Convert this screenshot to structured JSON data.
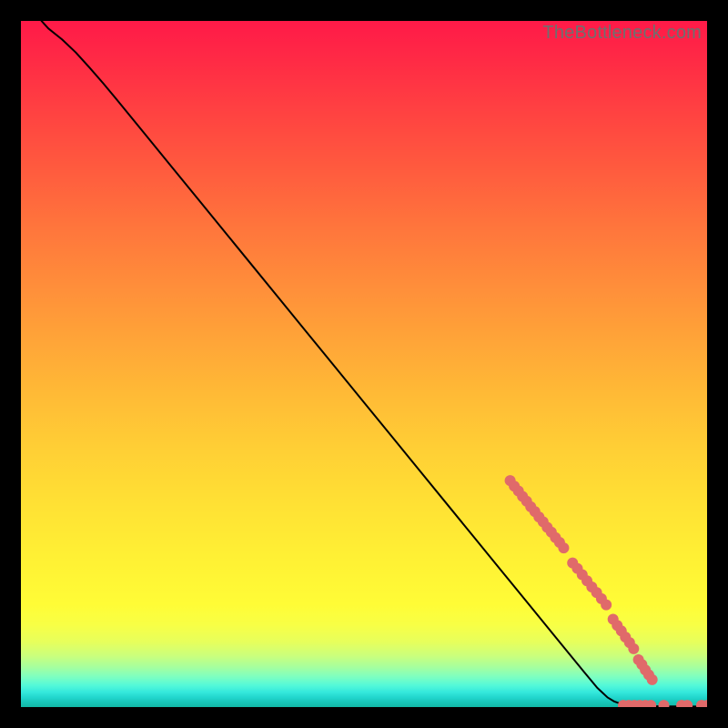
{
  "watermark": "TheBottleneck.com",
  "chart_data": {
    "type": "line",
    "title": "",
    "xlabel": "",
    "ylabel": "",
    "xlim": [
      0,
      100
    ],
    "ylim": [
      0,
      100
    ],
    "grid": false,
    "series": [
      {
        "name": "curve",
        "type": "line",
        "color": "#000000",
        "points": [
          {
            "x": 3.0,
            "y": 100.0
          },
          {
            "x": 4.0,
            "y": 98.9
          },
          {
            "x": 6.0,
            "y": 97.3
          },
          {
            "x": 8.0,
            "y": 95.4
          },
          {
            "x": 10.0,
            "y": 93.2
          },
          {
            "x": 12.0,
            "y": 90.9
          },
          {
            "x": 14.0,
            "y": 88.5
          },
          {
            "x": 18.0,
            "y": 83.6
          },
          {
            "x": 22.0,
            "y": 78.7
          },
          {
            "x": 26.0,
            "y": 73.8
          },
          {
            "x": 30.0,
            "y": 68.9
          },
          {
            "x": 34.0,
            "y": 64.0
          },
          {
            "x": 38.0,
            "y": 59.1
          },
          {
            "x": 42.0,
            "y": 54.2
          },
          {
            "x": 46.0,
            "y": 49.3
          },
          {
            "x": 50.0,
            "y": 44.4
          },
          {
            "x": 54.0,
            "y": 39.5
          },
          {
            "x": 58.0,
            "y": 34.6
          },
          {
            "x": 62.0,
            "y": 29.7
          },
          {
            "x": 66.0,
            "y": 24.8
          },
          {
            "x": 70.0,
            "y": 19.9
          },
          {
            "x": 74.0,
            "y": 15.0
          },
          {
            "x": 78.0,
            "y": 10.1
          },
          {
            "x": 82.0,
            "y": 5.2
          },
          {
            "x": 84.0,
            "y": 2.8
          },
          {
            "x": 85.5,
            "y": 1.4
          },
          {
            "x": 86.5,
            "y": 0.8
          },
          {
            "x": 87.5,
            "y": 0.45
          },
          {
            "x": 89.0,
            "y": 0.25
          },
          {
            "x": 91.0,
            "y": 0.15
          },
          {
            "x": 94.0,
            "y": 0.1
          },
          {
            "x": 97.0,
            "y": 0.08
          },
          {
            "x": 100.0,
            "y": 0.07
          }
        ]
      },
      {
        "name": "dots",
        "type": "scatter",
        "color": "#e06a6a",
        "radius_px": 6,
        "points": [
          {
            "x": 71.3,
            "y": 33.0
          },
          {
            "x": 71.9,
            "y": 32.2
          },
          {
            "x": 72.5,
            "y": 31.5
          },
          {
            "x": 73.1,
            "y": 30.7
          },
          {
            "x": 73.7,
            "y": 30.0
          },
          {
            "x": 74.3,
            "y": 29.2
          },
          {
            "x": 74.9,
            "y": 28.5
          },
          {
            "x": 75.5,
            "y": 27.7
          },
          {
            "x": 76.1,
            "y": 27.0
          },
          {
            "x": 76.7,
            "y": 26.2
          },
          {
            "x": 77.3,
            "y": 25.5
          },
          {
            "x": 77.9,
            "y": 24.7
          },
          {
            "x": 78.5,
            "y": 24.0
          },
          {
            "x": 79.1,
            "y": 23.2
          },
          {
            "x": 80.4,
            "y": 21.0
          },
          {
            "x": 81.1,
            "y": 20.2
          },
          {
            "x": 81.8,
            "y": 19.3
          },
          {
            "x": 82.5,
            "y": 18.4
          },
          {
            "x": 83.2,
            "y": 17.5
          },
          {
            "x": 83.9,
            "y": 16.7
          },
          {
            "x": 84.6,
            "y": 15.8
          },
          {
            "x": 85.3,
            "y": 14.9
          },
          {
            "x": 86.3,
            "y": 12.8
          },
          {
            "x": 86.9,
            "y": 11.9
          },
          {
            "x": 87.5,
            "y": 11.1
          },
          {
            "x": 88.1,
            "y": 10.2
          },
          {
            "x": 88.7,
            "y": 9.4
          },
          {
            "x": 89.3,
            "y": 8.5
          },
          {
            "x": 90.0,
            "y": 6.9
          },
          {
            "x": 90.5,
            "y": 6.2
          },
          {
            "x": 91.0,
            "y": 5.4
          },
          {
            "x": 91.5,
            "y": 4.7
          },
          {
            "x": 92.0,
            "y": 4.0
          },
          {
            "x": 87.8,
            "y": 0.25
          },
          {
            "x": 88.6,
            "y": 0.25
          },
          {
            "x": 89.4,
            "y": 0.25
          },
          {
            "x": 90.2,
            "y": 0.25
          },
          {
            "x": 91.0,
            "y": 0.25
          },
          {
            "x": 91.8,
            "y": 0.25
          },
          {
            "x": 93.7,
            "y": 0.25
          },
          {
            "x": 96.3,
            "y": 0.25
          },
          {
            "x": 97.1,
            "y": 0.25
          },
          {
            "x": 99.2,
            "y": 0.25
          },
          {
            "x": 100.0,
            "y": 0.25
          }
        ]
      }
    ]
  }
}
